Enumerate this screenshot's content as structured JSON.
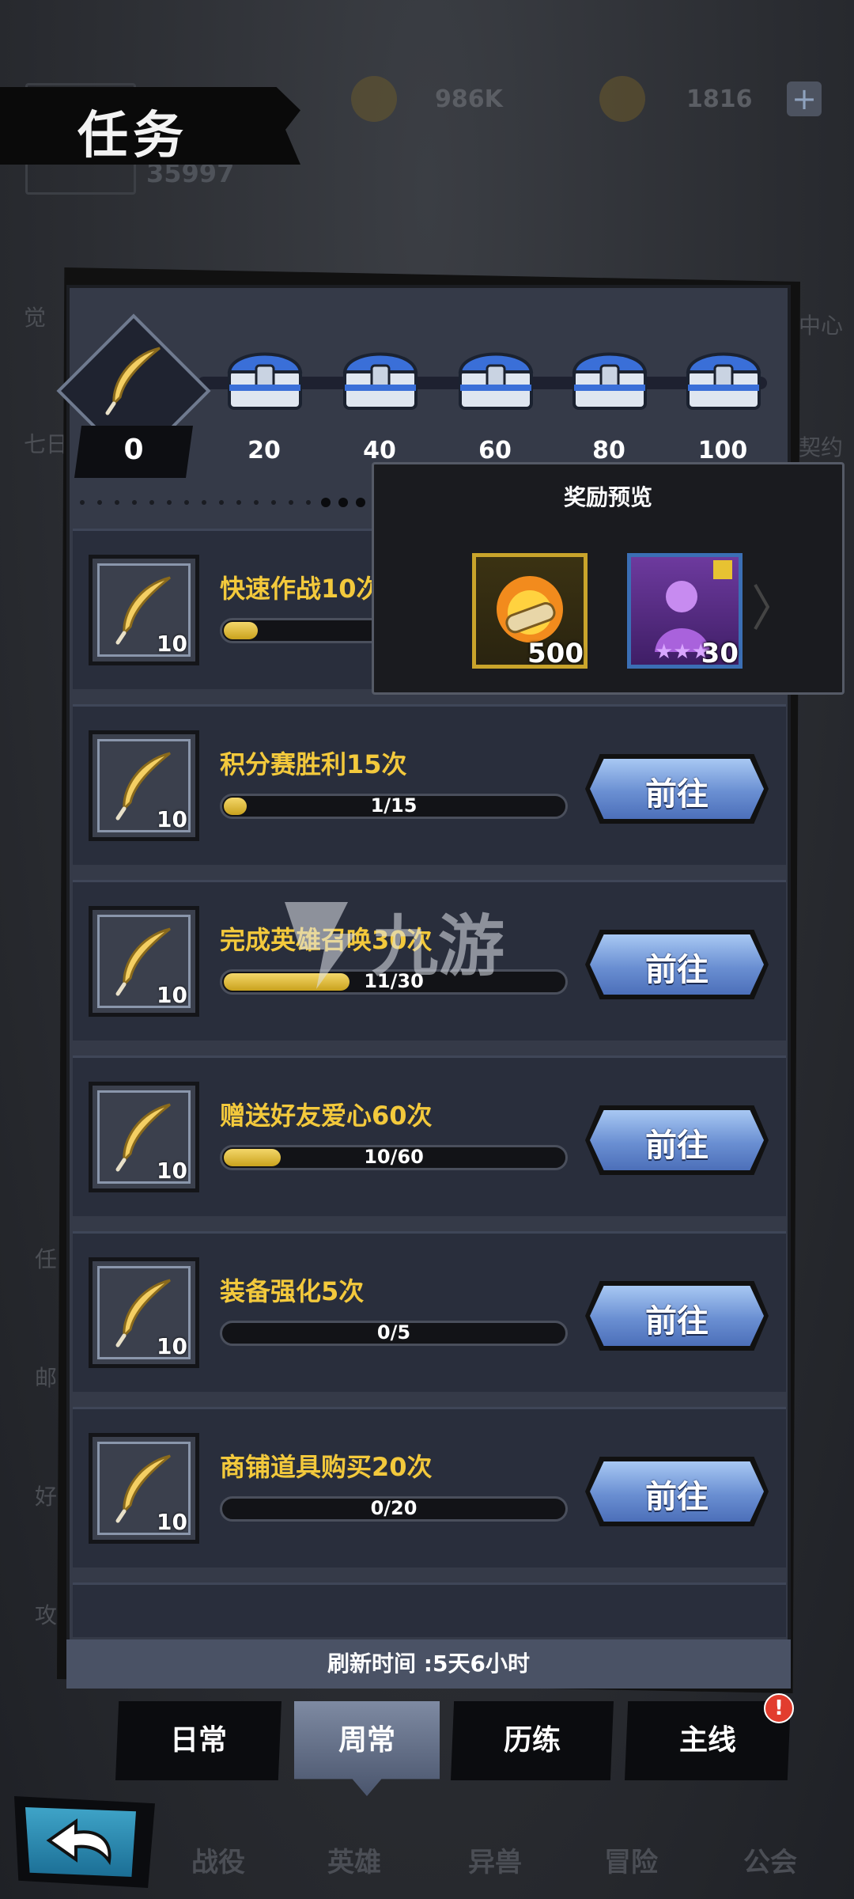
{
  "header": {
    "title": "任务",
    "gold": "986K",
    "gems": "1816",
    "plus": "+",
    "power": "35997"
  },
  "side_menu": {
    "left": [
      "觉",
      "七日",
      "任",
      "邮",
      "好",
      "攻"
    ],
    "right": [
      "中心",
      "契约"
    ]
  },
  "milestones": {
    "current": "0",
    "labels": [
      "20",
      "40",
      "60",
      "80",
      "100"
    ]
  },
  "reward_preview": {
    "title": "奖励预览",
    "items": [
      {
        "icon": "fire-scroll-icon",
        "count": "500"
      },
      {
        "icon": "hero-shard-icon",
        "count": "30"
      }
    ]
  },
  "tasks": [
    {
      "name": "快速作战10次",
      "points": "10",
      "progress": "1/10",
      "ratio": 0.1
    },
    {
      "name": "积分赛胜利15次",
      "points": "10",
      "progress": "1/15",
      "ratio": 0.067,
      "button": "前往"
    },
    {
      "name": "完成英雄召唤30次",
      "points": "10",
      "progress": "11/30",
      "ratio": 0.367,
      "button": "前往"
    },
    {
      "name": "赠送好友爱心60次",
      "points": "10",
      "progress": "10/60",
      "ratio": 0.167,
      "button": "前往"
    },
    {
      "name": "装备强化5次",
      "points": "10",
      "progress": "0/5",
      "ratio": 0,
      "button": "前往"
    },
    {
      "name": "商铺道具购买20次",
      "points": "10",
      "progress": "0/20",
      "ratio": 0,
      "button": "前往"
    }
  ],
  "refresh_text": "刷新时间 :5天6小时",
  "tabs": [
    "日常",
    "周常",
    "历练",
    "主线"
  ],
  "active_tab": "周常",
  "tab_badge": "!",
  "bottom_nav": [
    "战役",
    "英雄",
    "异兽",
    "冒险",
    "公会"
  ],
  "watermark": "九游",
  "colors": {
    "task_title": "#f3c93c",
    "go_button": "#6a8fd2",
    "panel": "#353a48",
    "badge": "#e23d2e"
  }
}
